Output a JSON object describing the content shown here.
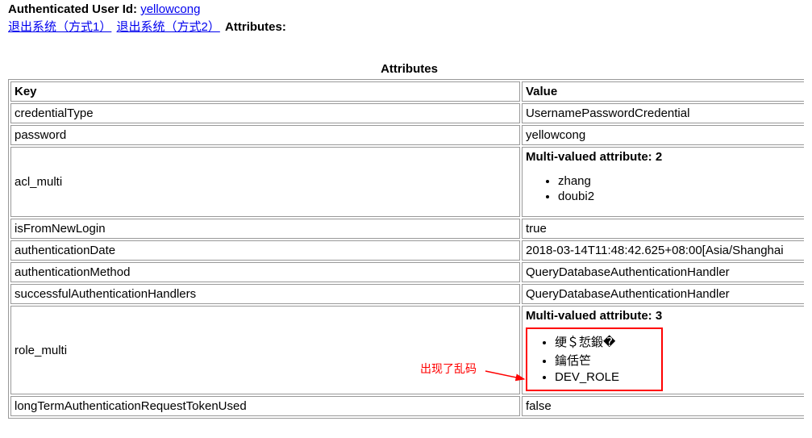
{
  "header": {
    "auth_user_label": "Authenticated User Id:",
    "auth_user_value": "yellowcong",
    "logout1": "退出系统（方式1）",
    "logout2": "退出系统（方式2）",
    "attributes_label": "Attributes:"
  },
  "table": {
    "caption": "Attributes",
    "col_key": "Key",
    "col_value": "Value",
    "rows": [
      {
        "key": "credentialType",
        "type": "simple",
        "value": "UsernamePasswordCredential"
      },
      {
        "key": "password",
        "type": "simple",
        "value": "yellowcong"
      },
      {
        "key": "acl_multi",
        "type": "multi",
        "count": 2,
        "values": [
          "zhang",
          "doubi2"
        ],
        "boxed": false
      },
      {
        "key": "isFromNewLogin",
        "type": "simple",
        "value": "true"
      },
      {
        "key": "authenticationDate",
        "type": "simple",
        "value": "2018-03-14T11:48:42.625+08:00[Asia/Shanghai"
      },
      {
        "key": "authenticationMethod",
        "type": "simple",
        "value": "QueryDatabaseAuthenticationHandler"
      },
      {
        "key": "successfulAuthenticationHandlers",
        "type": "simple",
        "value": "QueryDatabaseAuthenticationHandler"
      },
      {
        "key": "role_multi",
        "type": "multi",
        "count": 3,
        "values": [
          "绠＄悊鍛�",
          "鑰佸笀",
          "DEV_ROLE"
        ],
        "boxed": true
      },
      {
        "key": "longTermAuthenticationRequestTokenUsed",
        "type": "simple",
        "value": "false"
      }
    ],
    "multi_prefix": "Multi-valued attribute: "
  },
  "annotation": {
    "text": "出现了乱码"
  }
}
